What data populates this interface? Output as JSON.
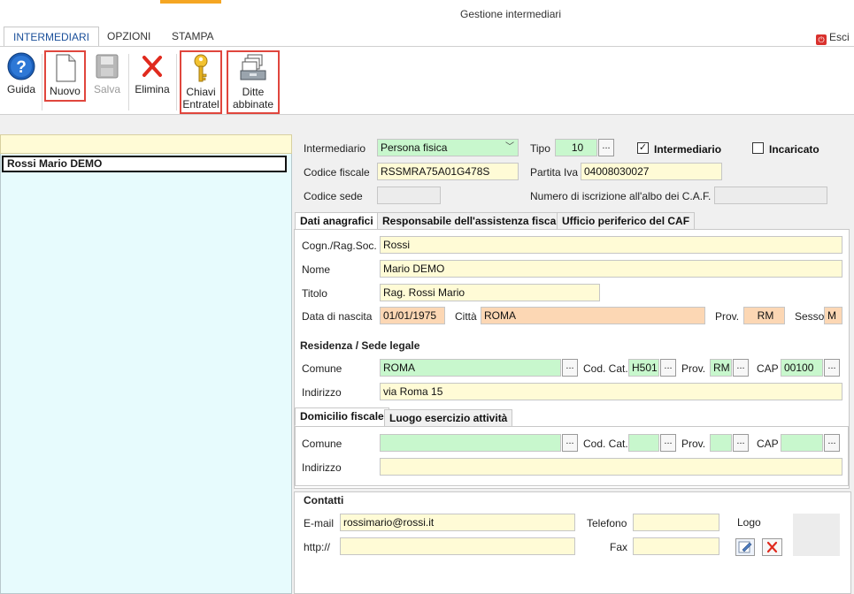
{
  "app": {
    "title": "Gestione intermediari",
    "exit_label": "Esci"
  },
  "ribbon_tabs": [
    "INTERMEDIARI",
    "OPZIONI",
    "STAMPA"
  ],
  "toolbar": {
    "guida": "Guida",
    "nuovo": "Nuovo",
    "salva": "Salva",
    "elimina": "Elimina",
    "chiavi_line1": "Chiavi",
    "chiavi_line2": "Entratel",
    "ditte_line1": "Ditte",
    "ditte_line2": "abbinate"
  },
  "list": {
    "items": [
      "Rossi Mario DEMO"
    ]
  },
  "form": {
    "intermediario_label": "Intermediario",
    "intermediario_value": "Persona fisica",
    "tipo_label": "Tipo",
    "tipo_value": "10",
    "chk_intermediario_label": "Intermediario",
    "chk_intermediario_checked": true,
    "chk_incaricato_label": "Incaricato",
    "chk_incaricato_checked": false,
    "codice_fiscale_label": "Codice fiscale",
    "codice_fiscale_value": "RSSMRA75A01G478S",
    "partita_iva_label": "Partita Iva",
    "partita_iva_value": "04008030027",
    "codice_sede_label": "Codice sede",
    "numero_iscrizione_label": "Numero di iscrizione all'albo dei C.A.F."
  },
  "tabs_anag": [
    "Dati anagrafici",
    "Responsabile dell'assistenza fiscale",
    "Ufficio periferico del CAF"
  ],
  "anagrafica": {
    "cognome_label": "Cogn./Rag.Soc.",
    "cognome_value": "Rossi",
    "nome_label": "Nome",
    "nome_value": "Mario DEMO",
    "titolo_label": "Titolo",
    "titolo_value": "Rag. Rossi  Mario",
    "data_nascita_label": "Data di nascita",
    "data_nascita_value": "01/01/1975",
    "citta_label": "Città",
    "citta_value": "ROMA",
    "prov_label": "Prov.",
    "prov_value": "RM",
    "sesso_label": "Sesso",
    "sesso_value": "M"
  },
  "residenza": {
    "title": "Residenza / Sede legale",
    "comune_label": "Comune",
    "comune_value": "ROMA",
    "codcat_label": "Cod. Cat.",
    "codcat_value": "H501",
    "prov_label": "Prov.",
    "prov_value": "RM",
    "cap_label": "CAP",
    "cap_value": "00100",
    "indirizzo_label": "Indirizzo",
    "indirizzo_value": "via Roma 15"
  },
  "tabs_domicilio": [
    "Domicilio fiscale",
    "Luogo esercizio attività"
  ],
  "domicilio": {
    "comune_label": "Comune",
    "codcat_label": "Cod. Cat.",
    "prov_label": "Prov.",
    "cap_label": "CAP",
    "indirizzo_label": "Indirizzo"
  },
  "contatti": {
    "title": "Contatti",
    "email_label": "E-mail",
    "email_value": "rossimario@rossi.it",
    "http_label": "http://",
    "telefono_label": "Telefono",
    "fax_label": "Fax",
    "logo_label": "Logo"
  },
  "dots_label": "..."
}
